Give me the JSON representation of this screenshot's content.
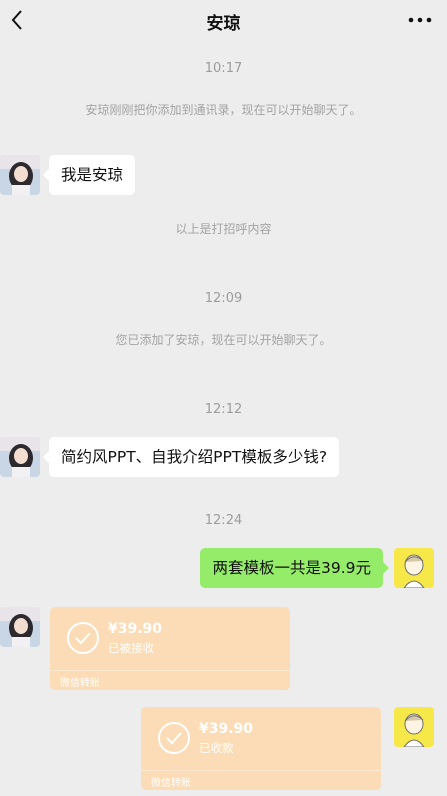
{
  "header": {
    "title": "安琼"
  },
  "messages": {
    "time1": "10:17",
    "sys1": "安琼刚刚把你添加到通讯录，现在可以开始聊天了。",
    "msg1": "我是安琼",
    "sys2": "以上是打招呼内容",
    "time2": "12:09",
    "sys3": "您已添加了安琼，现在可以开始聊天了。",
    "time3": "12:12",
    "msg2": "简约风PPT、自我介绍PPT模板多少钱?",
    "time4": "12:24",
    "msg3": "两套模板一共是39.9元"
  },
  "transfers": [
    {
      "amount": "¥39.90",
      "status": "已被接收",
      "label": "微信转账"
    },
    {
      "amount": "¥39.90",
      "status": "已收款",
      "label": "微信转账"
    }
  ],
  "colors": {
    "background": "#ededed",
    "bubble_sent": "#95ec69",
    "bubble_received": "#ffffff",
    "transfer_card": "#fbdcb6"
  },
  "icons": {
    "back": "chevron-left-icon",
    "more": "more-dots-icon",
    "transfer_done": "check-circle-icon"
  }
}
